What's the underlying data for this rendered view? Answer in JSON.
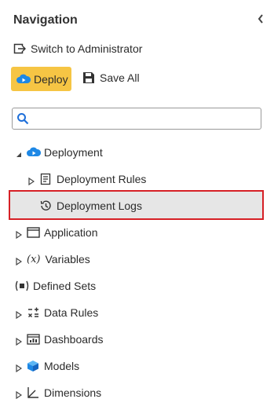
{
  "panel": {
    "title": "Navigation",
    "collapse_icon": "chevron-left-icon"
  },
  "actions": {
    "switch_label": "Switch to Administrator",
    "deploy_label": "Deploy",
    "save_all_label": "Save All"
  },
  "search": {
    "value": "",
    "placeholder": ""
  },
  "tree": {
    "deployment": {
      "label": "Deployment",
      "expanded": true
    },
    "deployment_rules": {
      "label": "Deployment Rules"
    },
    "deployment_logs": {
      "label": "Deployment Logs",
      "selected": true
    },
    "application": {
      "label": "Application"
    },
    "variables": {
      "label": "Variables"
    },
    "defined_sets": {
      "label": "Defined Sets"
    },
    "data_rules": {
      "label": "Data Rules"
    },
    "dashboards": {
      "label": "Dashboards"
    },
    "models": {
      "label": "Models"
    },
    "dimensions": {
      "label": "Dimensions"
    }
  },
  "colors": {
    "accent": "#f6c544",
    "selection_border": "#d62026",
    "selection_bg": "#e6e6e6",
    "icon_blue": "#1e88e5"
  }
}
